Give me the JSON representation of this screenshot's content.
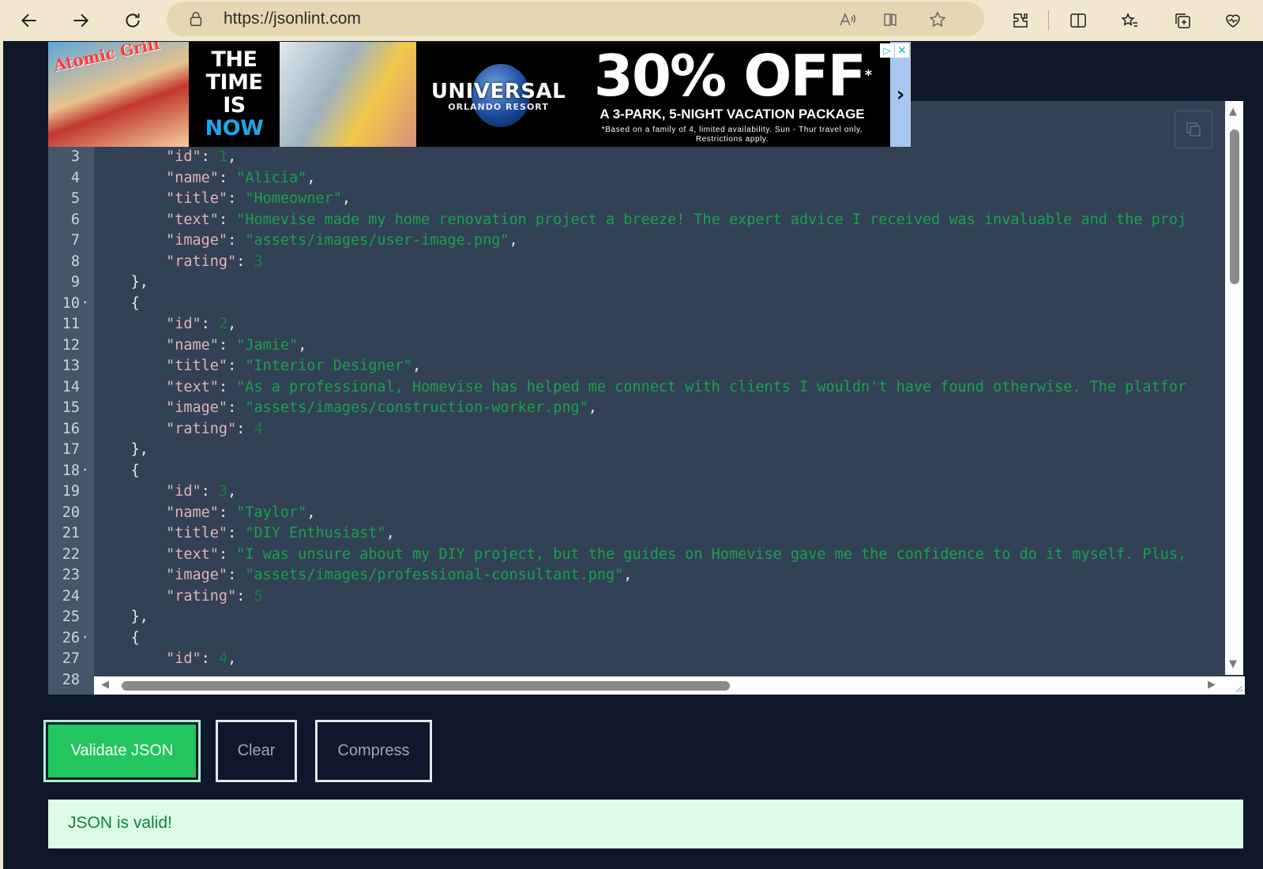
{
  "browser": {
    "url": "https://jsonlint.com",
    "icons": [
      "back-icon",
      "forward-icon",
      "refresh-icon",
      "lock-icon",
      "read-aloud-icon",
      "immersive-reader-icon",
      "favorite-icon",
      "extensions-icon",
      "split-screen-icon",
      "favorites-icon",
      "collections-icon",
      "browser-essentials-icon"
    ]
  },
  "ad": {
    "photo_logo": "Atomic Grill",
    "headline_lines": [
      "THE",
      "TIME",
      "IS",
      "NOW"
    ],
    "brand": "UNIVERSAL",
    "brand_sub": "ORLANDO RESORT",
    "offer": "30% OFF",
    "offer_star": "*",
    "offer_sub": "A 3-PARK, 5-NIGHT VACATION PACKAGE",
    "fine_print_1": "*Based on a family of 4, limited availability. Sun - Thur travel only.",
    "fine_print_2": "Restrictions apply.",
    "arrow": "›",
    "info": "▷",
    "close": "✕"
  },
  "editor": {
    "lines": [
      {
        "n": "3",
        "indent": "        ",
        "key": "\"id\"",
        "value": "1",
        "num": true,
        "trail": ","
      },
      {
        "n": "4",
        "indent": "        ",
        "key": "\"name\"",
        "value": "\"Alicia\"",
        "trail": ","
      },
      {
        "n": "5",
        "indent": "        ",
        "key": "\"title\"",
        "value": "\"Homeowner\"",
        "trail": ","
      },
      {
        "n": "6",
        "indent": "        ",
        "key": "\"text\"",
        "value": "\"Homevise made my home renovation project a breeze! The expert advice I received was invaluable and the proj",
        "trail": ""
      },
      {
        "n": "7",
        "indent": "        ",
        "key": "\"image\"",
        "value": "\"assets/images/user-image.png\"",
        "trail": ","
      },
      {
        "n": "8",
        "indent": "        ",
        "key": "\"rating\"",
        "value": "3",
        "num": true,
        "trail": ""
      },
      {
        "n": "9",
        "indent": "    ",
        "punct": "},"
      },
      {
        "n": "10",
        "indent": "    ",
        "punct": "{",
        "fold": true
      },
      {
        "n": "11",
        "indent": "        ",
        "key": "\"id\"",
        "value": "2",
        "num": true,
        "trail": ","
      },
      {
        "n": "12",
        "indent": "        ",
        "key": "\"name\"",
        "value": "\"Jamie\"",
        "trail": ","
      },
      {
        "n": "13",
        "indent": "        ",
        "key": "\"title\"",
        "value": "\"Interior Designer\"",
        "trail": ","
      },
      {
        "n": "14",
        "indent": "        ",
        "key": "\"text\"",
        "value": "\"As a professional, Homevise has helped me connect with clients I wouldn't have found otherwise. The platfor",
        "trail": ""
      },
      {
        "n": "15",
        "indent": "        ",
        "key": "\"image\"",
        "value": "\"assets/images/construction-worker.png\"",
        "trail": ","
      },
      {
        "n": "16",
        "indent": "        ",
        "key": "\"rating\"",
        "value": "4",
        "num": true,
        "trail": ""
      },
      {
        "n": "17",
        "indent": "    ",
        "punct": "},"
      },
      {
        "n": "18",
        "indent": "    ",
        "punct": "{",
        "fold": true
      },
      {
        "n": "19",
        "indent": "        ",
        "key": "\"id\"",
        "value": "3",
        "num": true,
        "trail": ","
      },
      {
        "n": "20",
        "indent": "        ",
        "key": "\"name\"",
        "value": "\"Taylor\"",
        "trail": ","
      },
      {
        "n": "21",
        "indent": "        ",
        "key": "\"title\"",
        "value": "\"DIY Enthusiast\"",
        "trail": ","
      },
      {
        "n": "22",
        "indent": "        ",
        "key": "\"text\"",
        "value": "\"I was unsure about my DIY project, but the guides on Homevise gave me the confidence to do it myself. Plus,",
        "trail": ""
      },
      {
        "n": "23",
        "indent": "        ",
        "key": "\"image\"",
        "value": "\"assets/images/professional-consultant.png\"",
        "trail": ","
      },
      {
        "n": "24",
        "indent": "        ",
        "key": "\"rating\"",
        "value": "5",
        "num": true,
        "trail": ""
      },
      {
        "n": "25",
        "indent": "    ",
        "punct": "},"
      },
      {
        "n": "26",
        "indent": "    ",
        "punct": "{",
        "fold": true
      },
      {
        "n": "27",
        "indent": "        ",
        "key": "\"id\"",
        "value": "4",
        "num": true,
        "trail": ","
      },
      {
        "n": "28",
        "indent": "",
        "punct": ""
      }
    ]
  },
  "buttons": {
    "validate": "Validate JSON",
    "clear": "Clear",
    "compress": "Compress"
  },
  "result": {
    "message": "JSON is valid!"
  }
}
